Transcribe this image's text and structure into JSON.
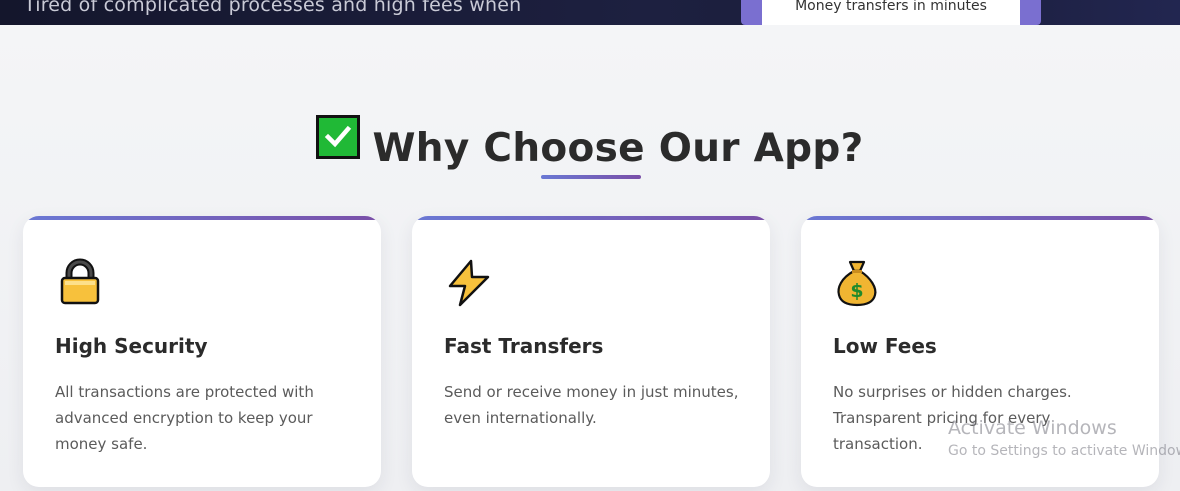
{
  "hero": {
    "partial_text": "Tired of complicated processes and high fees when",
    "phone_caption": "Money transfers in minutes"
  },
  "section": {
    "title": "Why Choose Our App?",
    "title_icon": "check-mark-button-icon"
  },
  "features": [
    {
      "icon": "lock-icon",
      "title": "High Security",
      "text": "All transactions are protected with advanced encryption to keep your money safe."
    },
    {
      "icon": "lightning-icon",
      "title": "Fast Transfers",
      "text": "Send or receive money in just minutes, even internationally."
    },
    {
      "icon": "money-bag-icon",
      "title": "Low Fees",
      "text": "No surprises or hidden charges. Transparent pricing for every transaction."
    }
  ],
  "watermark": {
    "title": "Activate Windows",
    "subtitle": "Go to Settings to activate Windows."
  },
  "colors": {
    "accent_start": "#6a78d4",
    "accent_end": "#7a4fa8",
    "check_green": "#20b936"
  }
}
